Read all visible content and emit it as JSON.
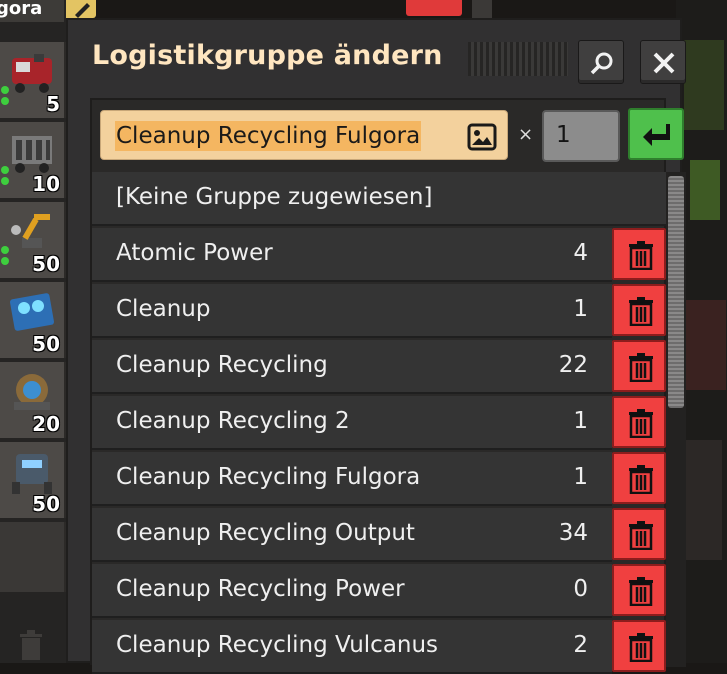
{
  "left_panel": {
    "top_label": "gora",
    "slots": [
      {
        "count": "5",
        "icon": "locomotive-icon",
        "dots": 2
      },
      {
        "count": "10",
        "icon": "cargo-wagon-icon",
        "dots": 2
      },
      {
        "count": "50",
        "icon": "inserter-icon",
        "dots": 2
      },
      {
        "count": "50",
        "icon": "module-icon",
        "dots": 0
      },
      {
        "count": "20",
        "icon": "assembler-icon",
        "dots": 0
      },
      {
        "count": "50",
        "icon": "machine-icon",
        "dots": 0
      }
    ]
  },
  "dialog": {
    "title": "Logistikgruppe ändern",
    "search_icon": "search-icon",
    "close_icon": "close-icon",
    "name_input_value": "Cleanup Recycling Fulgora",
    "multiplier_symbol": "×",
    "count_input_value": "1",
    "confirm_icon": "enter-icon",
    "no_group_label": "[Keine Gruppe zugewiesen]",
    "groups": [
      {
        "name": "Atomic Power",
        "count": "4"
      },
      {
        "name": "Cleanup",
        "count": "1"
      },
      {
        "name": "Cleanup Recycling",
        "count": "22"
      },
      {
        "name": "Cleanup Recycling 2",
        "count": "1"
      },
      {
        "name": "Cleanup Recycling Fulgora",
        "count": "1"
      },
      {
        "name": "Cleanup Recycling Output",
        "count": "34"
      },
      {
        "name": "Cleanup Recycling Power",
        "count": "0"
      },
      {
        "name": "Cleanup Recycling Vulcanus",
        "count": "2"
      }
    ]
  },
  "colors": {
    "title": "#ffe6c0",
    "delete_button": "#f04040",
    "confirm_button": "#4fc04c",
    "input_bg": "#f3d19d"
  }
}
